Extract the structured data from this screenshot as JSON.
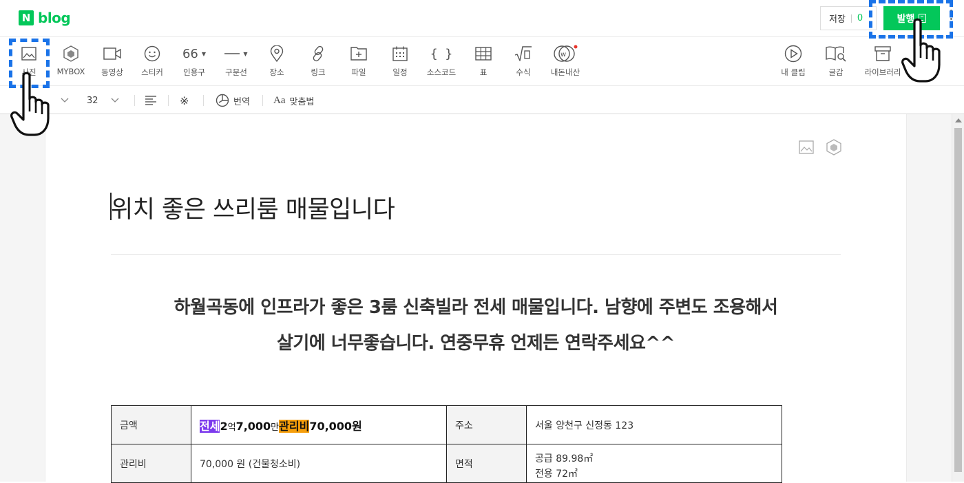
{
  "header": {
    "logo_letter": "N",
    "logo_text": "blog",
    "save_label": "저장",
    "save_count": "0",
    "publish_label": "발행"
  },
  "toolbar": {
    "left": [
      {
        "label": "사진",
        "icon": "photo-icon"
      },
      {
        "label": "MYBOX",
        "icon": "mybox-icon"
      },
      {
        "label": "동영상",
        "icon": "video-icon"
      },
      {
        "label": "스티커",
        "icon": "sticker-icon"
      },
      {
        "label": "인용구",
        "icon": "quote-icon",
        "glyph": "66"
      },
      {
        "label": "구분선",
        "icon": "divider-icon"
      },
      {
        "label": "장소",
        "icon": "place-icon"
      },
      {
        "label": "링크",
        "icon": "link-icon"
      },
      {
        "label": "파일",
        "icon": "file-icon"
      },
      {
        "label": "일정",
        "icon": "calendar-icon"
      },
      {
        "label": "소스코드",
        "icon": "code-icon",
        "glyph": "{ }"
      },
      {
        "label": "표",
        "icon": "table-icon"
      },
      {
        "label": "수식",
        "icon": "formula-icon"
      },
      {
        "label": "내돈내산",
        "icon": "purchase-icon"
      }
    ],
    "right": [
      {
        "label": "내 클립",
        "icon": "clip-icon"
      },
      {
        "label": "글감",
        "icon": "material-icon"
      },
      {
        "label": "라이브러리",
        "icon": "library-icon"
      }
    ]
  },
  "formatbar": {
    "font_size": "32",
    "symbol": "※",
    "translate_label": "번역",
    "spellcheck_label": "맞춤법",
    "spellcheck_glyph": "Aa"
  },
  "document": {
    "title": "위치 좋은 쓰리룸 매물입니다",
    "intro_line1": "하월곡동에 인프라가 좋은 3룸 신축빌라 전세 매물입니다. 남향에 주변도 조용해서",
    "intro_line2": "살기에 너무좋습니다. 연중무휴 언제든 연락주세요^^"
  },
  "info_table": {
    "row1": {
      "label1": "금액",
      "tag_lease": "전세",
      "price_a": "2",
      "unit_eok": "억",
      "price_b": "7,000",
      "unit_man": "만",
      "tag_fee": "관리비",
      "fee": "70,000원",
      "label2": "주소",
      "address": "서울 양천구 신정동 123"
    },
    "row2": {
      "label1": "관리비",
      "fee_detail": "70,000 원 (건물청소비)",
      "label2": "면적",
      "area_supply": "공급 89.98㎡",
      "area_exclusive": "전용 72㎡"
    }
  },
  "colors": {
    "brand_green": "#03c75a",
    "focus_blue": "#1a73e8",
    "highlight_purple": "#7c3aed",
    "highlight_orange": "#f59e0b"
  }
}
